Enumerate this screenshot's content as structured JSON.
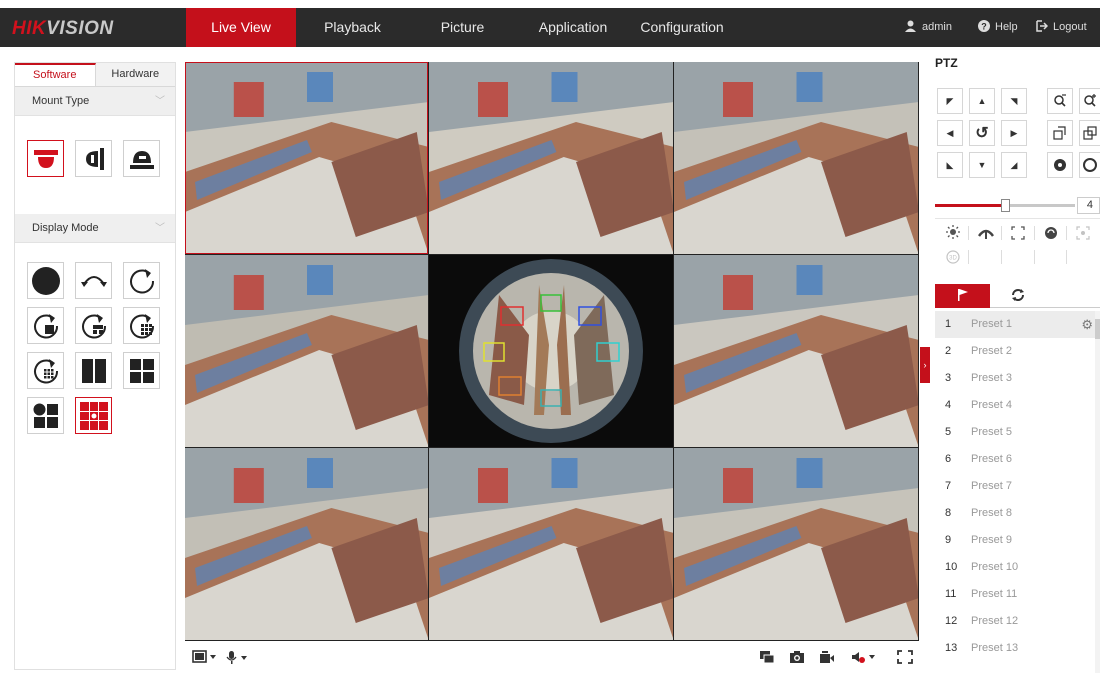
{
  "brand": {
    "logo_red": "HIK",
    "logo_grey": "VISION"
  },
  "nav": {
    "tabs": [
      "Live View",
      "Playback",
      "Picture",
      "Application",
      "Configuration"
    ],
    "active": "Live View"
  },
  "user": {
    "name": "admin",
    "help": "Help",
    "logout": "Logout"
  },
  "left_panel": {
    "tabs": [
      "Software",
      "Hardware"
    ],
    "active_tab": "Software",
    "mount_type": {
      "label": "Mount Type",
      "options": [
        "ceiling-mount-icon",
        "wall-mount-icon",
        "desktop-mount-icon"
      ],
      "selected": "ceiling-mount-icon"
    },
    "display_mode": {
      "label": "Display Mode",
      "options": [
        "fisheye-view-icon",
        "180-panorama-icon",
        "360-panorama-icon",
        "360-panorama-ptz-icon",
        "360-panorama-3ptz-icon",
        "360-panorama-6ptz-icon",
        "360-panorama-8ptz-icon",
        "half-dual-panorama-icon",
        "4-ptz-icon",
        "fisheye-3ptz-icon",
        "fisheye-8ptz-icon"
      ],
      "selected": "fisheye-8ptz-icon"
    }
  },
  "ptz": {
    "title": "PTZ",
    "speed": "4",
    "speed_fraction": 0.5,
    "presets_tab_icons": [
      "preset-flag-icon",
      "patrol-icon",
      "pattern-icon"
    ],
    "presets": [
      {
        "num": "1",
        "name": "Preset 1"
      },
      {
        "num": "2",
        "name": "Preset 2"
      },
      {
        "num": "3",
        "name": "Preset 3"
      },
      {
        "num": "4",
        "name": "Preset 4"
      },
      {
        "num": "5",
        "name": "Preset 5"
      },
      {
        "num": "6",
        "name": "Preset 6"
      },
      {
        "num": "7",
        "name": "Preset 7"
      },
      {
        "num": "8",
        "name": "Preset 8"
      },
      {
        "num": "9",
        "name": "Preset 9"
      },
      {
        "num": "10",
        "name": "Preset 10"
      },
      {
        "num": "11",
        "name": "Preset 11"
      },
      {
        "num": "12",
        "name": "Preset 12"
      },
      {
        "num": "13",
        "name": "Preset 13"
      }
    ]
  },
  "colors": {
    "accent": "#c4101b",
    "topbar": "#2b2b2b"
  }
}
